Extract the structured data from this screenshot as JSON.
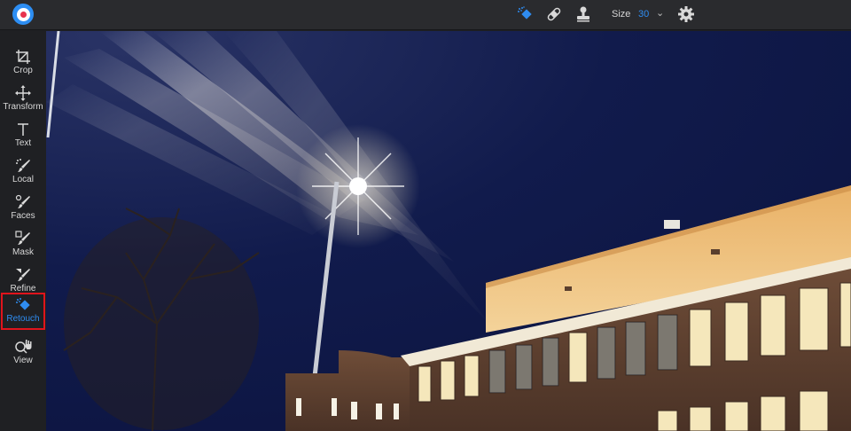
{
  "app": {
    "logo_icon": "app-logo-icon"
  },
  "toolbar": {
    "icons": [
      "retouch-brush-icon",
      "bandage-icon",
      "clone-stamp-icon"
    ],
    "size_label": "Size",
    "size_value": "30",
    "caret": "⌄",
    "settings_icon": "gear-icon",
    "accent_color": "#2f8cf0"
  },
  "sidebar": {
    "items": [
      {
        "label": "Crop",
        "icon": "crop-icon"
      },
      {
        "label": "Transform",
        "icon": "move-arrows-icon"
      },
      {
        "label": "Text",
        "icon": "text-t-icon"
      },
      {
        "label": "Local",
        "icon": "local-brush-icon"
      },
      {
        "label": "Faces",
        "icon": "faces-brush-icon"
      },
      {
        "label": "Mask",
        "icon": "mask-brush-icon"
      },
      {
        "label": "Refine",
        "icon": "refine-brush-icon"
      },
      {
        "label": "Retouch",
        "icon": "retouch-icon",
        "active": true
      },
      {
        "label": "View",
        "icon": "view-zoom-hand-icon"
      }
    ]
  },
  "canvas": {
    "description_icon": "night-photo-streetlight-building"
  }
}
